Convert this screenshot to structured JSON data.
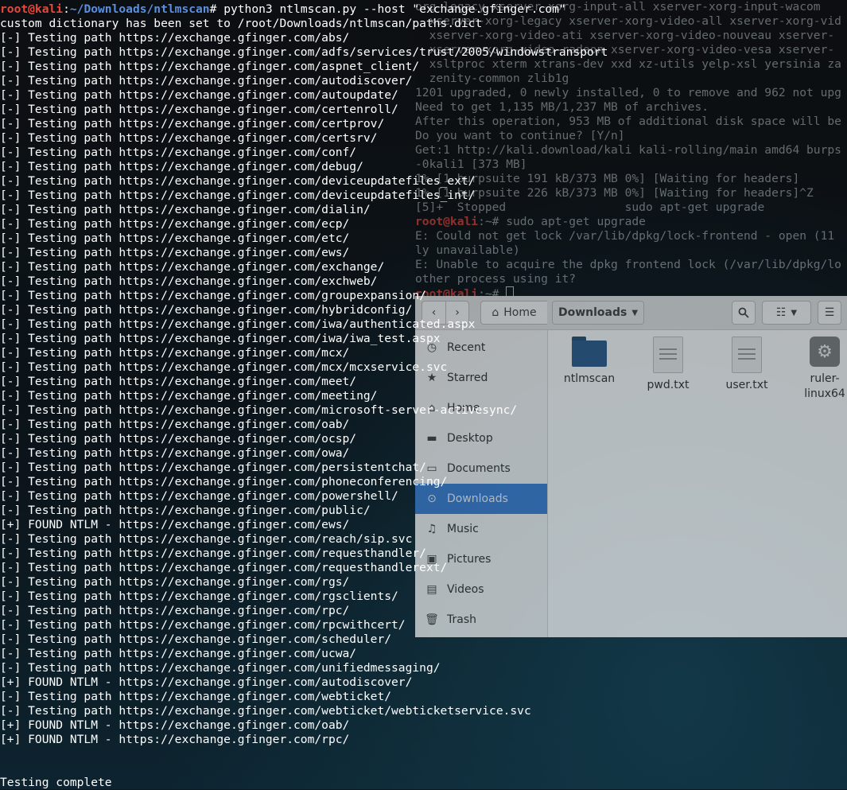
{
  "terminal": {
    "prompt_user": "root@kali",
    "prompt_sep": ":",
    "prompt_path": "~/Downloads/ntlmscan",
    "prompt_symbol": "# ",
    "command": "python3 ntlmscan.py --host \"exchange.gfinger.com\"",
    "lines": [
      "custom dictionary has been set to /root/Downloads/ntlmscan/paths.dict",
      "[-] Testing path https://exchange.gfinger.com/abs/",
      "[-] Testing path https://exchange.gfinger.com/adfs/services/trust/2005/windowstransport",
      "[-] Testing path https://exchange.gfinger.com/aspnet_client/",
      "[-] Testing path https://exchange.gfinger.com/autodiscover/",
      "[-] Testing path https://exchange.gfinger.com/autoupdate/",
      "[-] Testing path https://exchange.gfinger.com/certenroll/",
      "[-] Testing path https://exchange.gfinger.com/certprov/",
      "[-] Testing path https://exchange.gfinger.com/certsrv/",
      "[-] Testing path https://exchange.gfinger.com/conf/",
      "[-] Testing path https://exchange.gfinger.com/debug/",
      "[-] Testing path https://exchange.gfinger.com/deviceupdatefiles_ext/",
      "[-] Testing path https://exchange.gfinger.com/deviceupdatefiles_int/",
      "[-] Testing path https://exchange.gfinger.com/dialin/",
      "[-] Testing path https://exchange.gfinger.com/ecp/",
      "[-] Testing path https://exchange.gfinger.com/etc/",
      "[-] Testing path https://exchange.gfinger.com/ews/",
      "[-] Testing path https://exchange.gfinger.com/exchange/",
      "[-] Testing path https://exchange.gfinger.com/exchweb/",
      "[-] Testing path https://exchange.gfinger.com/groupexpansion/",
      "[-] Testing path https://exchange.gfinger.com/hybridconfig/",
      "[-] Testing path https://exchange.gfinger.com/iwa/authenticated.aspx",
      "[-] Testing path https://exchange.gfinger.com/iwa/iwa_test.aspx",
      "[-] Testing path https://exchange.gfinger.com/mcx/",
      "[-] Testing path https://exchange.gfinger.com/mcx/mcxservice.svc",
      "[-] Testing path https://exchange.gfinger.com/meet/",
      "[-] Testing path https://exchange.gfinger.com/meeting/",
      "[-] Testing path https://exchange.gfinger.com/microsoft-server-activesync/",
      "[-] Testing path https://exchange.gfinger.com/oab/",
      "[-] Testing path https://exchange.gfinger.com/ocsp/",
      "[-] Testing path https://exchange.gfinger.com/owa/",
      "[-] Testing path https://exchange.gfinger.com/persistentchat/",
      "[-] Testing path https://exchange.gfinger.com/phoneconferencing/",
      "[-] Testing path https://exchange.gfinger.com/powershell/",
      "[-] Testing path https://exchange.gfinger.com/public/",
      "[+] FOUND NTLM - https://exchange.gfinger.com/ews/",
      "[-] Testing path https://exchange.gfinger.com/reach/sip.svc",
      "[-] Testing path https://exchange.gfinger.com/requesthandler/",
      "[-] Testing path https://exchange.gfinger.com/requesthandlerext/",
      "[-] Testing path https://exchange.gfinger.com/rgs/",
      "[-] Testing path https://exchange.gfinger.com/rgsclients/",
      "[-] Testing path https://exchange.gfinger.com/rpc/",
      "[-] Testing path https://exchange.gfinger.com/rpcwithcert/",
      "[-] Testing path https://exchange.gfinger.com/scheduler/",
      "[-] Testing path https://exchange.gfinger.com/ucwa/",
      "[-] Testing path https://exchange.gfinger.com/unifiedmessaging/",
      "[+] FOUND NTLM - https://exchange.gfinger.com/autodiscover/",
      "[-] Testing path https://exchange.gfinger.com/webticket/",
      "[-] Testing path https://exchange.gfinger.com/webticket/webticketservice.svc",
      "[+] FOUND NTLM - https://exchange.gfinger.com/oab/",
      "[+] FOUND NTLM - https://exchange.gfinger.com/rpc/",
      "",
      "",
      "Testing complete"
    ]
  },
  "background_terminal": {
    "lines": [
      "org-legacy xserver-xorg-input-all xserver-xorg-input-wacom",
      "  xserver-xorg-legacy xserver-xorg-video-all xserver-xorg-vid",
      "  xserver-xorg-video-ati xserver-xorg-video-nouveau xserver-",
      "  xserver-xorg-video-radeon xserver-xorg-video-vesa xserver-",
      "  xsltproc xterm xtrans-dev xxd xz-utils yelp-xsl yersinia za",
      "  zenity-common zlib1g",
      "1201 upgraded, 0 newly installed, 0 to remove and 962 not upg",
      "Need to get 1,135 MB/1,237 MB of archives.",
      "After this operation, 953 MB of additional disk space will be",
      "Do you want to continue? [Y/n]",
      "Get:1 http://kali.download/kali kali-rolling/main amd64 burps",
      "-0kali1 [373 MB]",
      "1% [1 burpsuite 191 kB/373 MB 0%] [Waiting for headers]",
      "1% [1 burpsuite 226 kB/373 MB 0%] [Waiting for headers]^Z",
      "[5]+  Stopped                 sudo apt-get upgrade"
    ],
    "prompt1_user": "root@kali",
    "prompt1_rest": ":~# sudo apt-get upgrade",
    "error_lines": [
      "E: Could not get lock /var/lib/dpkg/lock-frontend - open (11",
      "ly unavailable)",
      "E: Unable to acquire the dpkg frontend lock (/var/lib/dpkg/lo",
      "other process using it?"
    ],
    "prompt2_user": "root@kali",
    "prompt2_rest": ":~# "
  },
  "file_manager": {
    "home_label": "Home",
    "location_label": "Downloads",
    "sidebar": [
      {
        "label": "Recent",
        "icon": "clock-icon",
        "glyph": "◷"
      },
      {
        "label": "Starred",
        "icon": "star-icon",
        "glyph": "★"
      },
      {
        "label": "Home",
        "icon": "home-icon",
        "glyph": "⌂"
      },
      {
        "label": "Desktop",
        "icon": "desktop-folder-icon",
        "glyph": "▬"
      },
      {
        "label": "Documents",
        "icon": "documents-icon",
        "glyph": "▭"
      },
      {
        "label": "Downloads",
        "icon": "downloads-icon",
        "glyph": "⊙"
      },
      {
        "label": "Music",
        "icon": "music-icon",
        "glyph": "♫"
      },
      {
        "label": "Pictures",
        "icon": "pictures-icon",
        "glyph": "▣"
      },
      {
        "label": "Videos",
        "icon": "videos-icon",
        "glyph": "▤"
      },
      {
        "label": "Trash",
        "icon": "trash-icon",
        "glyph": "🗑"
      }
    ],
    "active_item": "Downloads",
    "files": [
      {
        "name": "ntlmscan",
        "kind": "folder"
      },
      {
        "name": "pwd.txt",
        "kind": "text"
      },
      {
        "name": "user.txt",
        "kind": "text"
      },
      {
        "name": "ruler-\nlinux64",
        "kind": "executable"
      }
    ]
  },
  "colors": {
    "prompt_user": "#e8473c",
    "prompt_path": "#5a8ee0",
    "selection": "#3d7dd0"
  }
}
